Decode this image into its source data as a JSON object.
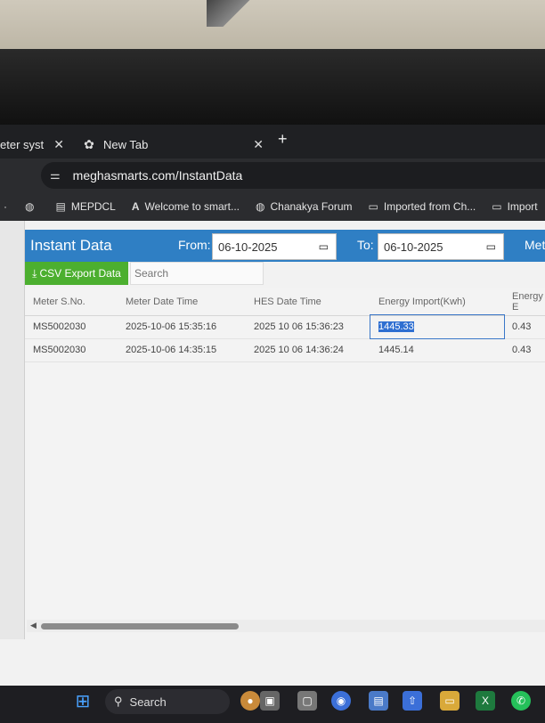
{
  "browser": {
    "tabs": [
      {
        "title": "eter syst",
        "close": "✕"
      },
      {
        "title": "New Tab",
        "close": "✕"
      }
    ],
    "new_tab": "+",
    "url": "meghasmarts.com/InstantData",
    "bookmarks": [
      {
        "icon": "globe-icon",
        "label": ""
      },
      {
        "icon": "site-icon",
        "label": "MEPDCL"
      },
      {
        "icon": "a-icon",
        "label": "Welcome to smart..."
      },
      {
        "icon": "globe-icon",
        "label": "Chanakya Forum"
      },
      {
        "icon": "folder-icon",
        "label": "Imported from Ch..."
      },
      {
        "icon": "folder-icon",
        "label": "Import"
      }
    ]
  },
  "page": {
    "title": "Instant Data",
    "from_label": "From:",
    "from_date": "06-10-2025",
    "to_label": "To:",
    "to_date": "06-10-2025",
    "extra_label": "Met",
    "csv_button": "CSV Export Data",
    "search_placeholder": "Search",
    "table": {
      "headers": [
        "Meter S.No.",
        "Meter Date Time",
        "HES Date Time",
        "Energy Import(Kwh)",
        "Energy E"
      ],
      "rows": [
        [
          "MS5002030",
          "2025-10-06 15:35:16",
          "2025 10 06 15:36:23",
          "1445.33",
          "0.43"
        ],
        [
          "MS5002030",
          "2025-10-06 14:35:15",
          "2025 10 06 14:36:24",
          "1445.14",
          "0.43"
        ]
      ]
    }
  },
  "taskbar": {
    "search_label": "Search"
  },
  "colors": {
    "header_blue": "#2f7fc4",
    "csv_green": "#4caf2f",
    "selection_blue": "#2f6fd1"
  }
}
